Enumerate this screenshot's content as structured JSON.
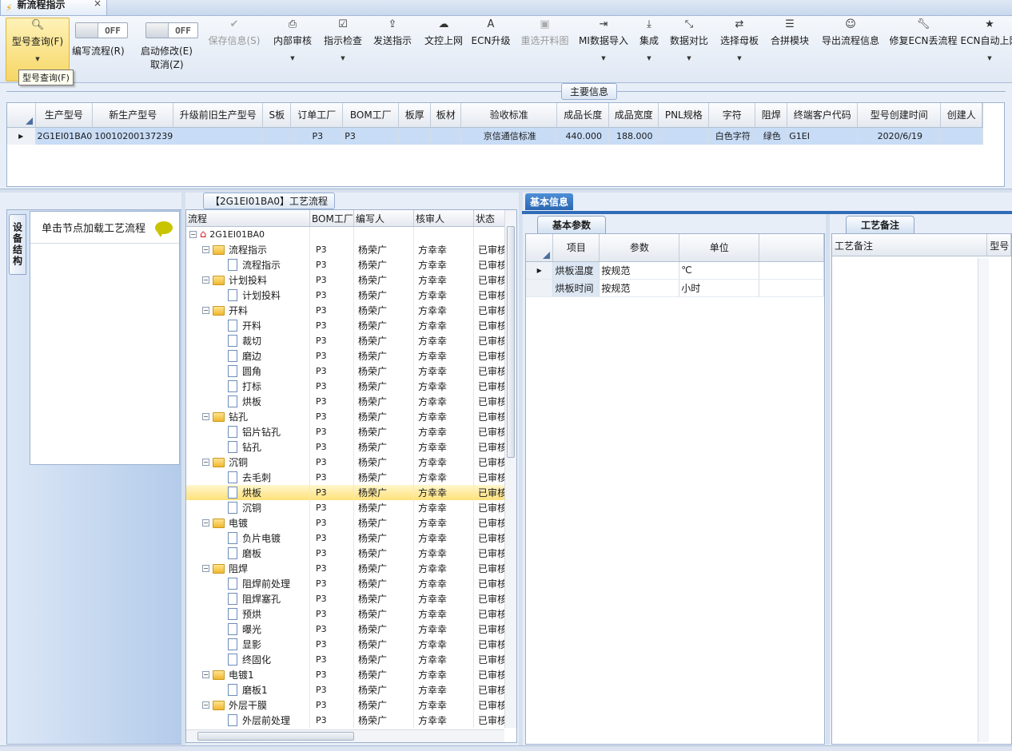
{
  "window": {
    "tab_title": "新流程指示",
    "close_symbol": "×"
  },
  "ribbon": {
    "query": {
      "label": "型号查询(F)",
      "icon": "search-icon"
    },
    "toggle_edit": {
      "state": "OFF",
      "label": "编写流程(R)"
    },
    "toggle_modify": {
      "state": "OFF",
      "label": "启动修改(E)",
      "sub_label": "取消(Z)"
    },
    "buttons": [
      {
        "label": "保存信息(S)",
        "icon": "check-icon",
        "disabled": true
      },
      {
        "label": "内部审核",
        "icon": "printer-icon",
        "disabled": false
      },
      {
        "label": "指示检查",
        "icon": "checkbox-icon",
        "disabled": false
      },
      {
        "label": "发送指示",
        "icon": "upload-icon",
        "disabled": false
      },
      {
        "label": "文控上网",
        "icon": "cloud-upload-icon",
        "disabled": false
      },
      {
        "label": "ECN升级",
        "icon": "font-icon",
        "disabled": false
      },
      {
        "label": "重选开料图",
        "icon": "image-icon",
        "disabled": true
      },
      {
        "label": "MI数据导入",
        "icon": "sign-in-icon",
        "disabled": false
      },
      {
        "label": "集成",
        "icon": "download-icon",
        "disabled": false
      },
      {
        "label": "数据对比",
        "icon": "compress-icon",
        "disabled": false
      },
      {
        "label": "选择母板",
        "icon": "shuffle-icon",
        "disabled": false
      },
      {
        "label": "合拼模块",
        "icon": "list-icon",
        "disabled": false
      },
      {
        "label": "导出流程信息",
        "icon": "smile-icon",
        "disabled": false
      },
      {
        "label": "修复ECN丢流程",
        "icon": "wrench-icon",
        "disabled": false
      },
      {
        "label": "ECN自动上网",
        "icon": "star-icon",
        "disabled": false
      }
    ],
    "tooltip": "型号查询(F)"
  },
  "main_info": {
    "title": "主要信息",
    "columns": [
      "生产型号",
      "新生产型号",
      "升级前旧生产型号",
      "S板",
      "订单工厂",
      "BOM工厂",
      "板厚",
      "板材",
      "验收标准",
      "成品长度",
      "成品宽度",
      "PNL规格",
      "字符",
      "阻焊",
      "终端客户代码",
      "型号创建时间",
      "创建人"
    ],
    "row": [
      "2G1EI01BA0",
      "10010200137239",
      "",
      "",
      "P3",
      "P3",
      "",
      "",
      "京信通信标准",
      "440.000",
      "188.000",
      "",
      "白色字符",
      "绿色",
      "G1EI",
      "2020/6/19",
      ""
    ]
  },
  "left_panel": {
    "vertical_tab": "设备结构",
    "hint": "单击节点加载工艺流程"
  },
  "tree": {
    "title": "【2G1EI01BA0】工艺流程",
    "columns": [
      "流程",
      "BOM工厂",
      "编写人",
      "核审人",
      "状态"
    ],
    "root": "2G1EI01BA0",
    "rows": [
      {
        "name": "流程指示",
        "level": 1,
        "folder": true,
        "factory": "P3",
        "writer": "杨荣广",
        "reviewer": "方幸幸",
        "status": "已审核"
      },
      {
        "name": "流程指示",
        "level": 2,
        "folder": false,
        "factory": "P3",
        "writer": "杨荣广",
        "reviewer": "方幸幸",
        "status": "已审核"
      },
      {
        "name": "计划投料",
        "level": 1,
        "folder": true,
        "factory": "P3",
        "writer": "杨荣广",
        "reviewer": "方幸幸",
        "status": "已审核"
      },
      {
        "name": "计划投料",
        "level": 2,
        "folder": false,
        "factory": "P3",
        "writer": "杨荣广",
        "reviewer": "方幸幸",
        "status": "已审核"
      },
      {
        "name": "开料",
        "level": 1,
        "folder": true,
        "factory": "P3",
        "writer": "杨荣广",
        "reviewer": "方幸幸",
        "status": "已审核"
      },
      {
        "name": "开料",
        "level": 2,
        "folder": false,
        "factory": "P3",
        "writer": "杨荣广",
        "reviewer": "方幸幸",
        "status": "已审核"
      },
      {
        "name": "裁切",
        "level": 2,
        "folder": false,
        "factory": "P3",
        "writer": "杨荣广",
        "reviewer": "方幸幸",
        "status": "已审核"
      },
      {
        "name": "磨边",
        "level": 2,
        "folder": false,
        "factory": "P3",
        "writer": "杨荣广",
        "reviewer": "方幸幸",
        "status": "已审核"
      },
      {
        "name": "圆角",
        "level": 2,
        "folder": false,
        "factory": "P3",
        "writer": "杨荣广",
        "reviewer": "方幸幸",
        "status": "已审核"
      },
      {
        "name": "打标",
        "level": 2,
        "folder": false,
        "factory": "P3",
        "writer": "杨荣广",
        "reviewer": "方幸幸",
        "status": "已审核"
      },
      {
        "name": "烘板",
        "level": 2,
        "folder": false,
        "factory": "P3",
        "writer": "杨荣广",
        "reviewer": "方幸幸",
        "status": "已审核"
      },
      {
        "name": "钻孔",
        "level": 1,
        "folder": true,
        "factory": "P3",
        "writer": "杨荣广",
        "reviewer": "方幸幸",
        "status": "已审核"
      },
      {
        "name": "铝片钻孔",
        "level": 2,
        "folder": false,
        "factory": "P3",
        "writer": "杨荣广",
        "reviewer": "方幸幸",
        "status": "已审核"
      },
      {
        "name": "钻孔",
        "level": 2,
        "folder": false,
        "factory": "P3",
        "writer": "杨荣广",
        "reviewer": "方幸幸",
        "status": "已审核"
      },
      {
        "name": "沉铜",
        "level": 1,
        "folder": true,
        "factory": "P3",
        "writer": "杨荣广",
        "reviewer": "方幸幸",
        "status": "已审核"
      },
      {
        "name": "去毛刺",
        "level": 2,
        "folder": false,
        "factory": "P3",
        "writer": "杨荣广",
        "reviewer": "方幸幸",
        "status": "已审核"
      },
      {
        "name": "烘板",
        "level": 2,
        "folder": false,
        "factory": "P3",
        "writer": "杨荣广",
        "reviewer": "方幸幸",
        "status": "已审核",
        "selected": true
      },
      {
        "name": "沉铜",
        "level": 2,
        "folder": false,
        "factory": "P3",
        "writer": "杨荣广",
        "reviewer": "方幸幸",
        "status": "已审核"
      },
      {
        "name": "电镀",
        "level": 1,
        "folder": true,
        "factory": "P3",
        "writer": "杨荣广",
        "reviewer": "方幸幸",
        "status": "已审核"
      },
      {
        "name": "负片电镀",
        "level": 2,
        "folder": false,
        "factory": "P3",
        "writer": "杨荣广",
        "reviewer": "方幸幸",
        "status": "已审核"
      },
      {
        "name": "磨板",
        "level": 2,
        "folder": false,
        "factory": "P3",
        "writer": "杨荣广",
        "reviewer": "方幸幸",
        "status": "已审核"
      },
      {
        "name": "阻焊",
        "level": 1,
        "folder": true,
        "factory": "P3",
        "writer": "杨荣广",
        "reviewer": "方幸幸",
        "status": "已审核"
      },
      {
        "name": "阻焊前处理",
        "level": 2,
        "folder": false,
        "factory": "P3",
        "writer": "杨荣广",
        "reviewer": "方幸幸",
        "status": "已审核"
      },
      {
        "name": "阻焊塞孔",
        "level": 2,
        "folder": false,
        "factory": "P3",
        "writer": "杨荣广",
        "reviewer": "方幸幸",
        "status": "已审核"
      },
      {
        "name": "预烘",
        "level": 2,
        "folder": false,
        "factory": "P3",
        "writer": "杨荣广",
        "reviewer": "方幸幸",
        "status": "已审核"
      },
      {
        "name": "曝光",
        "level": 2,
        "folder": false,
        "factory": "P3",
        "writer": "杨荣广",
        "reviewer": "方幸幸",
        "status": "已审核"
      },
      {
        "name": "显影",
        "level": 2,
        "folder": false,
        "factory": "P3",
        "writer": "杨荣广",
        "reviewer": "方幸幸",
        "status": "已审核"
      },
      {
        "name": "终固化",
        "level": 2,
        "folder": false,
        "factory": "P3",
        "writer": "杨荣广",
        "reviewer": "方幸幸",
        "status": "已审核"
      },
      {
        "name": "电镀1",
        "level": 1,
        "folder": true,
        "factory": "P3",
        "writer": "杨荣广",
        "reviewer": "方幸幸",
        "status": "已审核"
      },
      {
        "name": "磨板1",
        "level": 2,
        "folder": false,
        "factory": "P3",
        "writer": "杨荣广",
        "reviewer": "方幸幸",
        "status": "已审核"
      },
      {
        "name": "外层干膜",
        "level": 1,
        "folder": true,
        "factory": "P3",
        "writer": "杨荣广",
        "reviewer": "方幸幸",
        "status": "已审核"
      },
      {
        "name": "外层前处理",
        "level": 2,
        "folder": false,
        "factory": "P3",
        "writer": "杨荣广",
        "reviewer": "方幸幸",
        "status": "已审核"
      }
    ]
  },
  "basic_info": {
    "tab": "基本信息",
    "params_tab": "基本参数",
    "columns": [
      "项目",
      "参数",
      "单位"
    ],
    "rows": [
      {
        "item": "烘板温度",
        "value": "按规范",
        "unit": "℃"
      },
      {
        "item": "烘板时间",
        "value": "按规范",
        "unit": "小时"
      }
    ],
    "notes_tab": "工艺备注",
    "notes_columns": [
      "工艺备注",
      "型号"
    ]
  }
}
